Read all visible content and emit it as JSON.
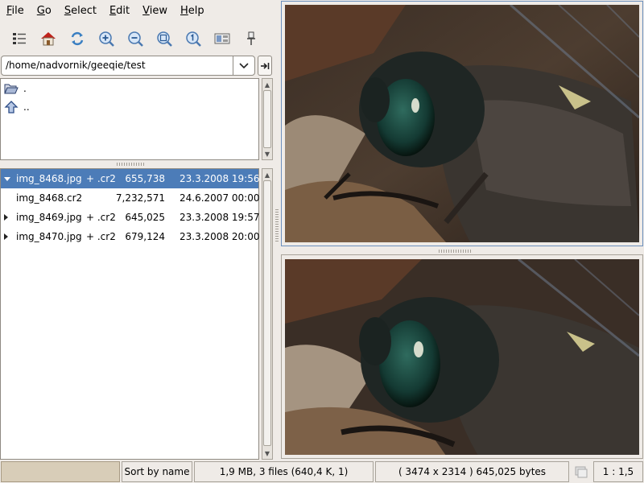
{
  "menubar": {
    "items": [
      {
        "accel": "F",
        "rest": "ile"
      },
      {
        "accel": "G",
        "rest": "o"
      },
      {
        "accel": "S",
        "rest": "elect"
      },
      {
        "accel": "E",
        "rest": "dit"
      },
      {
        "accel": "V",
        "rest": "iew"
      },
      {
        "accel": "H",
        "rest": "elp"
      }
    ]
  },
  "toolbar": {
    "icons": [
      "thumbnails-icon",
      "home-icon",
      "refresh-icon",
      "zoom-in-icon",
      "zoom-out-icon",
      "zoom-fit-icon",
      "zoom-1-1-icon",
      "layout-icon",
      "pin-icon"
    ]
  },
  "path": {
    "value": "/home/nadvornik/geeqie/test"
  },
  "dirs": [
    {
      "label": ".",
      "icon": "folder-open-icon"
    },
    {
      "label": "..",
      "icon": "up-arrow-icon"
    }
  ],
  "files": [
    {
      "name": "img_8468.jpg",
      "side": "+ .cr2",
      "size": "655,738",
      "date": "23.3.2008 19:56",
      "expander": "expanded",
      "selected": true
    },
    {
      "name": "img_8468.cr2",
      "side": "",
      "size": "7,232,571",
      "date": "24.6.2007 00:00",
      "expander": "none",
      "selected": false
    },
    {
      "name": "img_8469.jpg",
      "side": "+ .cr2",
      "size": "645,025",
      "date": "23.3.2008 19:57",
      "expander": "collapsed",
      "selected": false
    },
    {
      "name": "img_8470.jpg",
      "side": "+ .cr2",
      "size": "679,124",
      "date": "23.3.2008 20:00",
      "expander": "collapsed",
      "selected": false
    }
  ],
  "status": {
    "sort": "Sort by name",
    "summary": "1,9 MB, 3 files (640,4 K, 1)",
    "image_info": "( 3474 x 2314 ) 645,025 bytes",
    "zoom": "1 : 1,5"
  },
  "colors": {
    "selection": "#4c7cb8",
    "window_bg": "#efebe7",
    "progress_fill": "#d8cdb8"
  }
}
